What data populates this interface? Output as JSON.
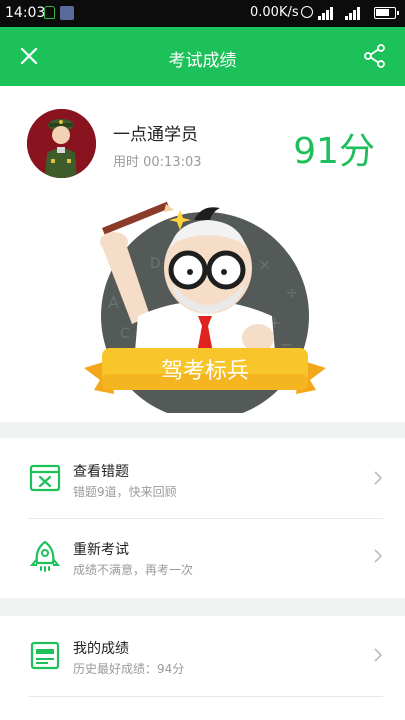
{
  "status_bar": {
    "time": "14:03",
    "network_speed": "0.00K/s"
  },
  "app_bar": {
    "title": "考试成绩",
    "close_icon": "close-icon",
    "share_icon": "share-icon"
  },
  "result": {
    "username": "一点通学员",
    "time_used": "用时 00:13:03",
    "score": "91分",
    "badge_title": "驾考标兵"
  },
  "actions": [
    {
      "title": "查看错题",
      "subtitle": "错题9道，快来回顾",
      "icon": "wrong-questions-icon"
    },
    {
      "title": "重新考试",
      "subtitle": "成绩不满意，再考一次",
      "icon": "rocket-icon"
    },
    {
      "title": "我的成绩",
      "subtitle": "历史最好成绩：94分",
      "icon": "record-icon"
    }
  ],
  "colors": {
    "brand_green": "#1cc15a",
    "badge_yellow": "#f8c62a"
  }
}
